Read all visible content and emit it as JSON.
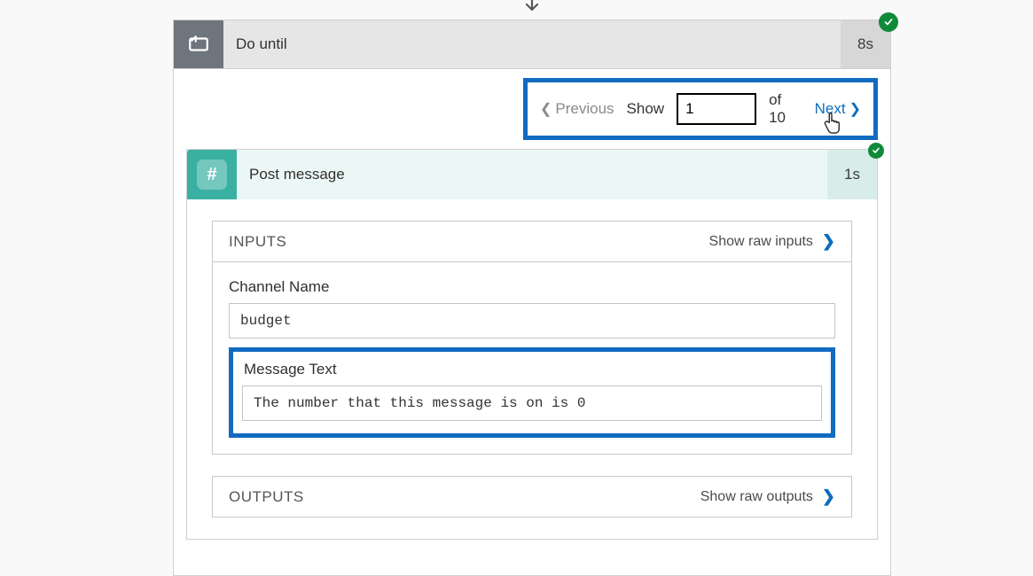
{
  "doUntil": {
    "title": "Do until",
    "duration": "8s"
  },
  "pager": {
    "previous": "Previous",
    "show": "Show",
    "value": "1",
    "of": "of 10",
    "next": "Next"
  },
  "postMessage": {
    "title": "Post message",
    "duration": "1s",
    "iconGlyph": "#"
  },
  "inputs": {
    "heading": "INPUTS",
    "rawLink": "Show raw inputs",
    "channel": {
      "label": "Channel Name",
      "value": "budget"
    },
    "message": {
      "label": "Message Text",
      "value": "The number that this message is on is 0"
    }
  },
  "outputs": {
    "heading": "OUTPUTS",
    "rawLink": "Show raw outputs"
  }
}
